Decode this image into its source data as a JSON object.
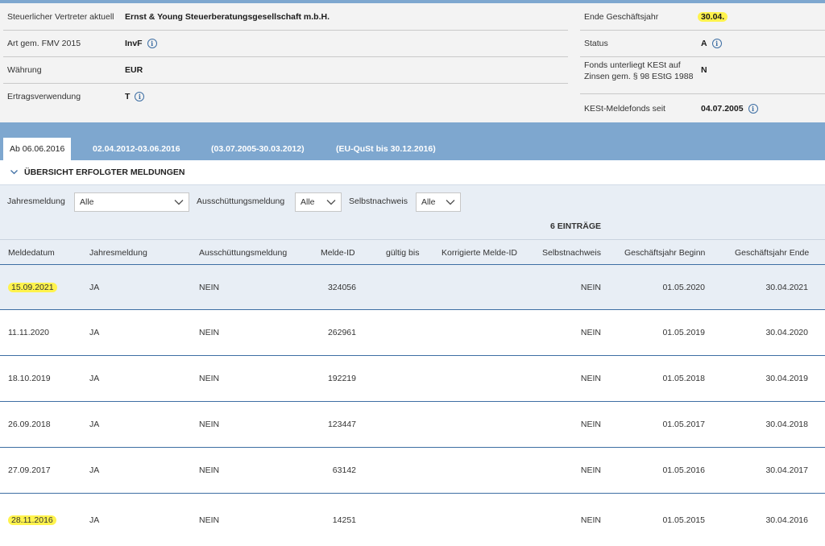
{
  "info": {
    "rows": [
      {
        "label": "Steuerlicher Vertreter aktuell",
        "value": "Ernst & Young Steuerberatungsgesellschaft m.b.H.",
        "info": false
      },
      {
        "label": "Art gem. FMV 2015",
        "value": "InvF",
        "info": true
      },
      {
        "label": "Währung",
        "value": "EUR",
        "info": false
      },
      {
        "label": "Ertragsverwendung",
        "value": "T",
        "info": true
      }
    ],
    "right_rows": [
      {
        "label": "Ende Geschäftsjahr",
        "value": "30.04.",
        "info": false,
        "highlight": true
      },
      {
        "label": "Status",
        "value": "A",
        "info": true,
        "highlight": false
      },
      {
        "label": "Fonds unterliegt KESt auf Zinsen gem. § 98 EStG 1988",
        "value": "N",
        "info": false,
        "highlight": false
      },
      {
        "label": "KESt-Meldefonds seit",
        "value": "04.07.2005",
        "info": true,
        "highlight": false
      }
    ]
  },
  "tabs": [
    {
      "label": "Ab 06.06.2016",
      "active": true
    },
    {
      "label": "02.04.2012-03.06.2016",
      "active": false
    },
    {
      "label": "(03.07.2005-30.03.2012)",
      "active": false
    },
    {
      "label": "(EU-QuSt bis 30.12.2016)",
      "active": false
    }
  ],
  "section": {
    "title": "ÜBERSICHT ERFOLGTER MELDUNGEN",
    "chevron_icon": "chevron-down-icon"
  },
  "filters": {
    "jahresmeldung": {
      "label": "Jahresmeldung",
      "value": "Alle"
    },
    "ausschuettungsmeldung": {
      "label": "Ausschüttungsmeldung",
      "value": "Alle"
    },
    "selbstnachweis": {
      "label": "Selbstnachweis",
      "value": "Alle"
    }
  },
  "count_label": "6 EINTRÄGE",
  "table": {
    "columns": [
      "Meldedatum",
      "Jahresmeldung",
      "Ausschüttungsmeldung",
      "Melde-ID",
      "gültig bis",
      "Korrigierte Melde-ID",
      "Selbstnachweis",
      "Geschäftsjahr Beginn",
      "Geschäftsjahr Ende"
    ],
    "rows": [
      {
        "meldedatum": "15.09.2021",
        "jahresmeldung": "JA",
        "ausschuettung": "NEIN",
        "melde_id": "324056",
        "gueltig_bis": "",
        "korr_id": "",
        "selbstnachweis": "NEIN",
        "gj_beginn": "01.05.2020",
        "gj_ende": "30.04.2021",
        "highlight": true
      },
      {
        "meldedatum": "11.11.2020",
        "jahresmeldung": "JA",
        "ausschuettung": "NEIN",
        "melde_id": "262961",
        "gueltig_bis": "",
        "korr_id": "",
        "selbstnachweis": "NEIN",
        "gj_beginn": "01.05.2019",
        "gj_ende": "30.04.2020",
        "highlight": false
      },
      {
        "meldedatum": "18.10.2019",
        "jahresmeldung": "JA",
        "ausschuettung": "NEIN",
        "melde_id": "192219",
        "gueltig_bis": "",
        "korr_id": "",
        "selbstnachweis": "NEIN",
        "gj_beginn": "01.05.2018",
        "gj_ende": "30.04.2019",
        "highlight": false
      },
      {
        "meldedatum": "26.09.2018",
        "jahresmeldung": "JA",
        "ausschuettung": "NEIN",
        "melde_id": "123447",
        "gueltig_bis": "",
        "korr_id": "",
        "selbstnachweis": "NEIN",
        "gj_beginn": "01.05.2017",
        "gj_ende": "30.04.2018",
        "highlight": false
      },
      {
        "meldedatum": "27.09.2017",
        "jahresmeldung": "JA",
        "ausschuettung": "NEIN",
        "melde_id": "63142",
        "gueltig_bis": "",
        "korr_id": "",
        "selbstnachweis": "NEIN",
        "gj_beginn": "01.05.2016",
        "gj_ende": "30.04.2017",
        "highlight": false
      },
      {
        "meldedatum": "28.11.2016",
        "jahresmeldung": "JA",
        "ausschuettung": "NEIN",
        "melde_id": "14251",
        "gueltig_bis": "",
        "korr_id": "",
        "selbstnachweis": "NEIN",
        "gj_beginn": "01.05.2015",
        "gj_ende": "30.04.2016",
        "highlight": true
      }
    ]
  },
  "colors": {
    "accent": "#7ea7cf",
    "row_line": "#3d6ea3",
    "filter_bg": "#e8eef5",
    "highlight": "#fff34d"
  }
}
